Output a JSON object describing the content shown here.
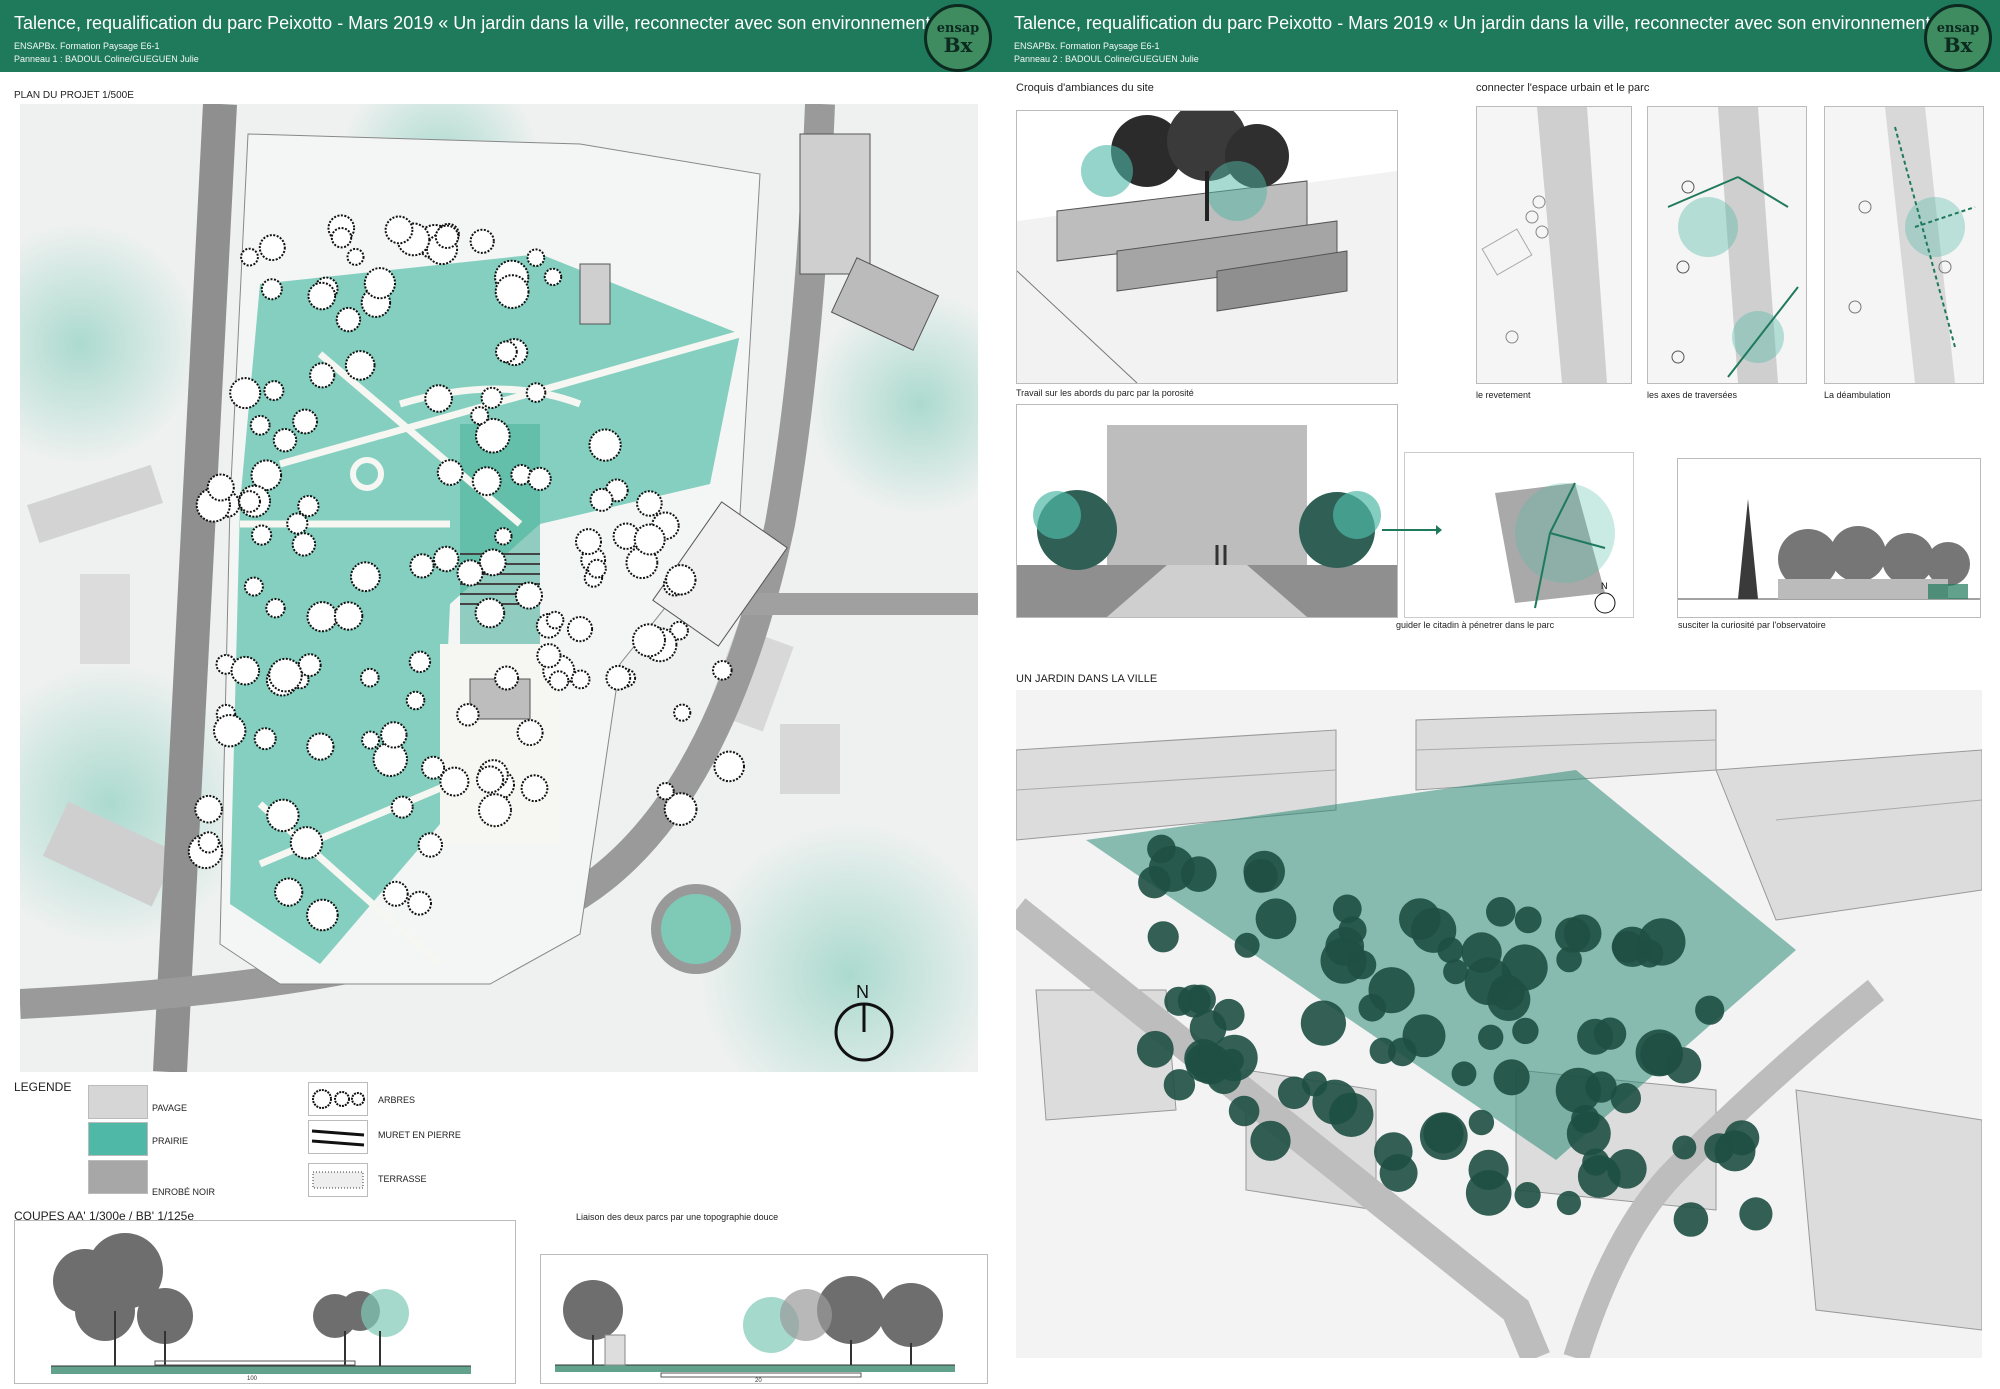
{
  "panel1": {
    "title": "Talence, requalification du parc Peixotto - Mars 2019    « Un jardin dans la ville, reconnecter avec son environnement»",
    "sub1": "ENSAPBx. Formation Paysage E6-1",
    "sub2": "Panneau 1 : BADOUL Coline/GUEGUEN Julie",
    "plan_label": "PLAN DU PROJET 1/500E",
    "north": "N",
    "legend_title": "LEGENDE",
    "legend": {
      "pavage": "PAVAGE",
      "prairie": "PRAIRIE",
      "enrobe": "ENROBÉ NOIR",
      "arbres": "ARBRES",
      "muret": "MURET EN PIERRE",
      "terrasse": "TERRASSE"
    },
    "coupes_label": "COUPES AA' 1/300e / BB' 1/125e",
    "liaison_label": "Liaison des deux parcs par une topographie douce",
    "scale1": "100",
    "scale2": "20"
  },
  "panel2": {
    "title": "Talence, requalification du parc Peixotto - Mars 2019    « Un jardin dans la ville, reconnecter avec son environnement»",
    "sub1": "ENSAPBx. Formation Paysage E6-1",
    "sub2": "Panneau 2 : BADOUL Coline/GUEGUEN Julie",
    "croquis_label": "Croquis d'ambiances du site",
    "connecter_label": "connecter l'espace urbain et le parc",
    "caption_revetement": "le revetement",
    "caption_axes": "les axes de traversées",
    "caption_deambulation": "La déambulation",
    "caption_porosite": "Travail sur les abords du parc par la porosité",
    "caption_guider": "guider le citadin à pénetrer dans le parc",
    "caption_curiosite": "susciter la curiosité par l'observatoire",
    "north": "N",
    "jardin_label": "UN JARDIN DANS LA VILLE"
  },
  "logo": {
    "line1": "ensap",
    "line2": "Bx"
  },
  "colors": {
    "banner": "#1f7a5c",
    "prairie": "#4fb8a6",
    "tree": "#1e4f43"
  }
}
